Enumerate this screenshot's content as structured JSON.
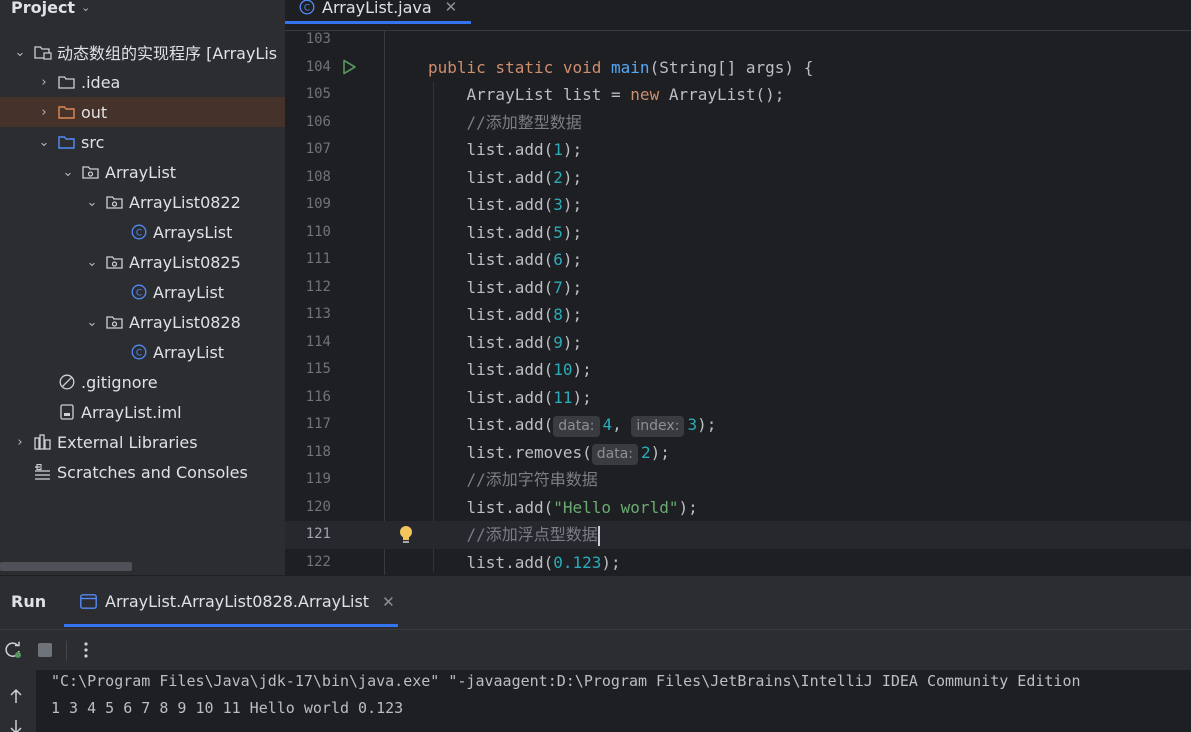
{
  "project_panel": {
    "title": "Project",
    "tree": [
      {
        "label": "动态数组的实现程序 [ArrayLis",
        "indent": 0,
        "arrow": "⌄",
        "icon": "module-folder-icon",
        "bold": false
      },
      {
        "label": ".idea",
        "indent": 1,
        "arrow": "›",
        "icon": "folder-icon"
      },
      {
        "label": "out",
        "indent": 1,
        "arrow": "›",
        "icon": "excluded-folder-icon",
        "selected": true
      },
      {
        "label": "src",
        "indent": 1,
        "arrow": "⌄",
        "icon": "source-folder-icon"
      },
      {
        "label": "ArrayList",
        "indent": 2,
        "arrow": "⌄",
        "icon": "package-icon"
      },
      {
        "label": "ArrayList0822",
        "indent": 3,
        "arrow": "⌄",
        "icon": "package-icon"
      },
      {
        "label": "ArraysList",
        "indent": 4,
        "arrow": "",
        "icon": "java-class-icon"
      },
      {
        "label": "ArrayList0825",
        "indent": 3,
        "arrow": "⌄",
        "icon": "package-icon"
      },
      {
        "label": "ArrayList",
        "indent": 4,
        "arrow": "",
        "icon": "java-class-icon"
      },
      {
        "label": "ArrayList0828",
        "indent": 3,
        "arrow": "⌄",
        "icon": "package-icon"
      },
      {
        "label": "ArrayList",
        "indent": 4,
        "arrow": "",
        "icon": "java-class-icon"
      },
      {
        "label": ".gitignore",
        "indent": 1,
        "arrow": "",
        "icon": "gitignore-icon"
      },
      {
        "label": "ArrayList.iml",
        "indent": 1,
        "arrow": "",
        "icon": "iml-file-icon"
      },
      {
        "label": "External Libraries",
        "indent": 0,
        "arrow": "›",
        "icon": "libraries-icon"
      },
      {
        "label": "Scratches and Consoles",
        "indent": 0,
        "arrow": "",
        "icon": "scratches-icon"
      }
    ]
  },
  "editor": {
    "tab_label": "ArrayList.java",
    "current_line": 121,
    "lines": [
      {
        "num": "103",
        "tokens": []
      },
      {
        "num": "104",
        "tokens": [
          [
            "kw",
            "public static void "
          ],
          [
            "fn",
            "main"
          ],
          [
            "p",
            "(String[] args) {"
          ]
        ]
      },
      {
        "num": "105",
        "tokens": [
          [
            "p",
            "    ArrayList list = "
          ],
          [
            "kw",
            "new "
          ],
          [
            "p",
            "ArrayList();"
          ]
        ]
      },
      {
        "num": "106",
        "tokens": [
          [
            "cm",
            "    //添加整型数据"
          ]
        ]
      },
      {
        "num": "107",
        "tokens": [
          [
            "p",
            "    list.add("
          ],
          [
            "num",
            "1"
          ],
          [
            "p",
            ");"
          ]
        ]
      },
      {
        "num": "108",
        "tokens": [
          [
            "p",
            "    list.add("
          ],
          [
            "num",
            "2"
          ],
          [
            "p",
            ");"
          ]
        ]
      },
      {
        "num": "109",
        "tokens": [
          [
            "p",
            "    list.add("
          ],
          [
            "num",
            "3"
          ],
          [
            "p",
            ");"
          ]
        ]
      },
      {
        "num": "110",
        "tokens": [
          [
            "p",
            "    list.add("
          ],
          [
            "num",
            "5"
          ],
          [
            "p",
            ");"
          ]
        ]
      },
      {
        "num": "111",
        "tokens": [
          [
            "p",
            "    list.add("
          ],
          [
            "num",
            "6"
          ],
          [
            "p",
            ");"
          ]
        ]
      },
      {
        "num": "112",
        "tokens": [
          [
            "p",
            "    list.add("
          ],
          [
            "num",
            "7"
          ],
          [
            "p",
            ");"
          ]
        ]
      },
      {
        "num": "113",
        "tokens": [
          [
            "p",
            "    list.add("
          ],
          [
            "num",
            "8"
          ],
          [
            "p",
            ");"
          ]
        ]
      },
      {
        "num": "114",
        "tokens": [
          [
            "p",
            "    list.add("
          ],
          [
            "num",
            "9"
          ],
          [
            "p",
            ");"
          ]
        ]
      },
      {
        "num": "115",
        "tokens": [
          [
            "p",
            "    list.add("
          ],
          [
            "num",
            "10"
          ],
          [
            "p",
            ");"
          ]
        ]
      },
      {
        "num": "116",
        "tokens": [
          [
            "p",
            "    list.add("
          ],
          [
            "num",
            "11"
          ],
          [
            "p",
            ");"
          ]
        ]
      },
      {
        "num": "117",
        "tokens": [
          [
            "p",
            "    list.add("
          ],
          [
            "hint",
            "data:"
          ],
          [
            "num",
            "4"
          ],
          [
            "p",
            ", "
          ],
          [
            "hint",
            "index:"
          ],
          [
            "num",
            "3"
          ],
          [
            "p",
            ");"
          ]
        ]
      },
      {
        "num": "118",
        "tokens": [
          [
            "p",
            "    list.removes("
          ],
          [
            "hint",
            "data:"
          ],
          [
            "num",
            "2"
          ],
          [
            "p",
            ");"
          ]
        ]
      },
      {
        "num": "119",
        "tokens": [
          [
            "cm",
            "    //添加字符串数据"
          ]
        ]
      },
      {
        "num": "120",
        "tokens": [
          [
            "p",
            "    list.add("
          ],
          [
            "str",
            "\"Hello world\""
          ],
          [
            "p",
            ");"
          ]
        ]
      },
      {
        "num": "121",
        "tokens": [
          [
            "cm",
            "    //添加浮点型数据"
          ],
          [
            "caret",
            ""
          ]
        ]
      },
      {
        "num": "122",
        "tokens": [
          [
            "p",
            "    list.add("
          ],
          [
            "num",
            "0.123"
          ],
          [
            "p",
            ");"
          ]
        ]
      }
    ]
  },
  "run_panel": {
    "title": "Run",
    "tab_label": "ArrayList.ArrayList0828.ArrayList",
    "console_lines": [
      "\"C:\\Program Files\\Java\\jdk-17\\bin\\java.exe\" \"-javaagent:D:\\Program Files\\JetBrains\\IntelliJ IDEA Community Edition",
      "1 3 4 5 6 7 8 9 10 11 Hello world 0.123"
    ]
  },
  "colors": {
    "accent": "#3574f0",
    "selection": "#45322b",
    "keyword": "#cf8e6d",
    "function": "#56a8f5",
    "number": "#2aacb8",
    "string": "#6aab73",
    "comment": "#7a7e85"
  }
}
